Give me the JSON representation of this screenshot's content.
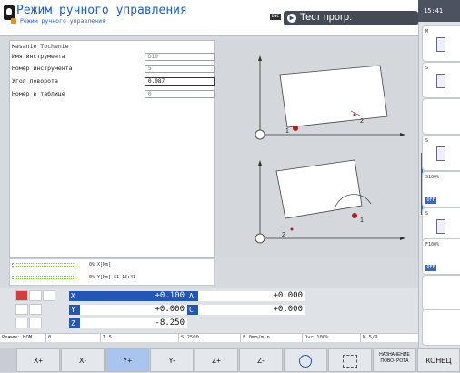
{
  "header": {
    "mode_title": "Режим ручного управления",
    "mode_subtitle": "Режим ручного управления",
    "dnc_label": "DNC",
    "program_title": "Тест прогр.",
    "clock": "15:41"
  },
  "form": {
    "title": "Kasanie Tochenie",
    "rows": [
      {
        "label": "Имя инструмента",
        "value": "D10"
      },
      {
        "label": "Номер инструмента",
        "value": "5"
      },
      {
        "label": "Угол поворота",
        "value": "0.087"
      },
      {
        "label": "Номер в таблице",
        "value": "0"
      }
    ]
  },
  "graphic": {
    "top_labels": {
      "p1": "1",
      "p2": "2"
    },
    "bottom_labels": {
      "p1": "1",
      "p2": "2"
    }
  },
  "status": {
    "x_text": "0% X[Nm]",
    "y_text": "0% Y[Nm] S1  15:41"
  },
  "positions": [
    {
      "axis": "X",
      "value": "+0.100",
      "axis2": "A",
      "value2": "+0.000"
    },
    {
      "axis": "Y",
      "value": "+0.000",
      "axis2": "C",
      "value2": "+0.000"
    },
    {
      "axis": "Z",
      "value": "-8.250"
    }
  ],
  "statusline": {
    "mode": "Режим: НОМ.",
    "zero": "0",
    "tool": "T 5",
    "spindle": "S 2500",
    "feed": "F 0mm/min",
    "override": "Ovr 100%",
    "m_func": "M 5/9"
  },
  "right_softkeys": [
    {
      "label": "M"
    },
    {
      "label": "S"
    },
    {
      "label": ""
    },
    {
      "label": "S"
    },
    {
      "label": "S100%",
      "off": "OFF"
    },
    {
      "label": "S"
    },
    {
      "label": ""
    },
    {
      "label": "F100%",
      "off": "OFF"
    },
    {
      "label": ""
    },
    {
      "label": ""
    }
  ],
  "softkeys": {
    "xplus": "X+",
    "xminus": "X-",
    "yplus": "Y+",
    "yminus": "Y-",
    "zplus": "Z+",
    "zminus": "Z-",
    "assign": "НАЗНАЧЕНИЕ ПОВО- РОТА",
    "end": "КОНЕЦ"
  },
  "colors": {
    "accent": "#2456b5",
    "title": "#1f5fbf",
    "selected_softkey": "#a9c4ee"
  }
}
